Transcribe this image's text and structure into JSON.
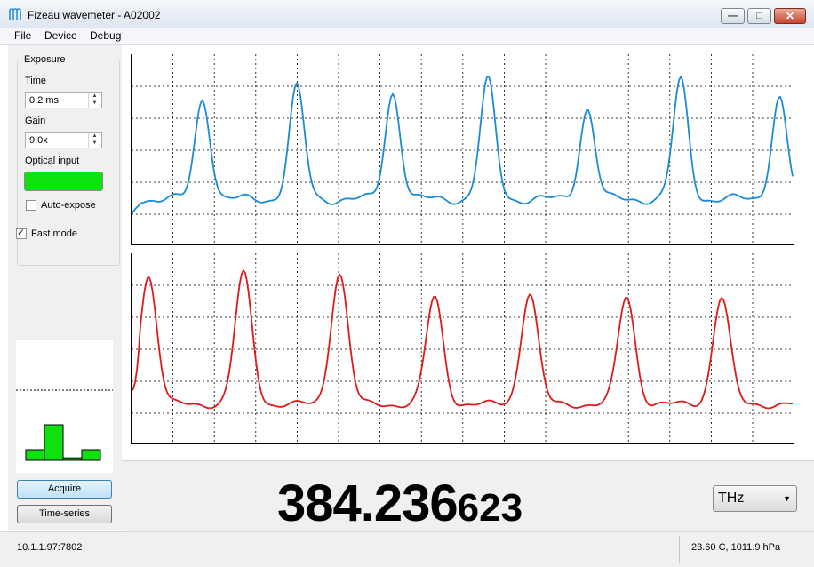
{
  "window": {
    "title": "Fizeau wavemeter - A02002",
    "logo_icon": "fizeau-logo-icon"
  },
  "menu": {
    "items": [
      "File",
      "Device",
      "Debug"
    ]
  },
  "exposure": {
    "group_title": "Exposure",
    "time_label": "Time",
    "time_value": "0.2 ms",
    "gain_label": "Gain",
    "gain_value": "9.0x",
    "optical_input_label": "Optical input",
    "optical_input_color": "#0ee20e",
    "auto_expose_label": "Auto-expose",
    "auto_expose_checked": false
  },
  "fast_mode": {
    "label": "Fast mode",
    "checked": true
  },
  "buttons": {
    "acquire": "Acquire",
    "time_series": "Time-series"
  },
  "reading": {
    "main": "384.236",
    "small": "623"
  },
  "unit": {
    "selected": "THz"
  },
  "status": {
    "connection": "10.1.1.97:7802",
    "environment": "23.60 C, 1011.9 hPa"
  },
  "colors": {
    "top_trace": "#1a8bd6",
    "bottom_trace": "#e01a1a",
    "histogram_bars": "#10e010"
  },
  "histogram": {
    "bars": [
      0.3,
      1.0,
      0.07,
      0.3
    ]
  }
}
